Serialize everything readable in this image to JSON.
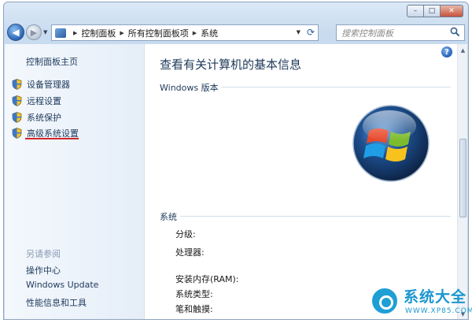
{
  "titlebar": {
    "buttons": {
      "minimize": "–",
      "maximize": "□",
      "close": "✕"
    }
  },
  "navbar": {
    "breadcrumbs": [
      "控制面板",
      "所有控制面板项",
      "系统"
    ],
    "search_placeholder": "搜索控制面板"
  },
  "sidebar": {
    "home": "控制面板主页",
    "tasks": [
      {
        "label": "设备管理器",
        "icon": "shield-icon"
      },
      {
        "label": "远程设置",
        "icon": "shield-icon"
      },
      {
        "label": "系统保护",
        "icon": "shield-icon"
      },
      {
        "label": "高级系统设置",
        "icon": "shield-icon"
      }
    ],
    "see_also_heading": "另请参阅",
    "see_also": [
      "操作中心",
      "Windows Update",
      "性能信息和工具"
    ]
  },
  "main": {
    "title": "查看有关计算机的基本信息",
    "edition_heading": "Windows 版本",
    "system_heading": "系统",
    "rating_label": "分级:",
    "processor_label": "处理器:",
    "ram_label": "安装内存(RAM):",
    "system_type_label": "系统类型:",
    "pen_touch_label": "笔和触摸:"
  },
  "watermark": {
    "title": "系统大全",
    "url": "WWW.XP85.COM"
  },
  "colors": {
    "accent": "#1e395b",
    "highlight_underline": "#d3262a",
    "watermark": "#1b97d0"
  }
}
